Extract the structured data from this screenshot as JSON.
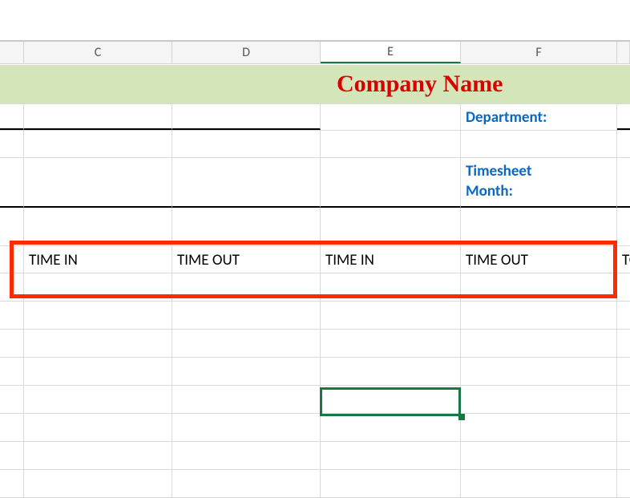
{
  "columns": {
    "c": "C",
    "d": "D",
    "e": "E",
    "f": "F"
  },
  "active_column": "E",
  "title_text": "Company Name",
  "labels": {
    "department": "Department:",
    "timesheet_month_l1": "Timesheet",
    "timesheet_month_l2": "Month:"
  },
  "table_headers": {
    "h1": "TIME IN",
    "h2": "TIME OUT",
    "h3": "TIME IN",
    "h4": "TIME OUT",
    "h5": "TO"
  },
  "chart_data": {
    "type": "table",
    "title": "Company Name",
    "columns_visible": [
      "C",
      "D",
      "E",
      "F"
    ],
    "header_row": [
      "TIME IN",
      "TIME OUT",
      "TIME IN",
      "TIME OUT"
    ],
    "metadata_fields": [
      "Department:",
      "Timesheet Month:"
    ],
    "data_rows": []
  }
}
